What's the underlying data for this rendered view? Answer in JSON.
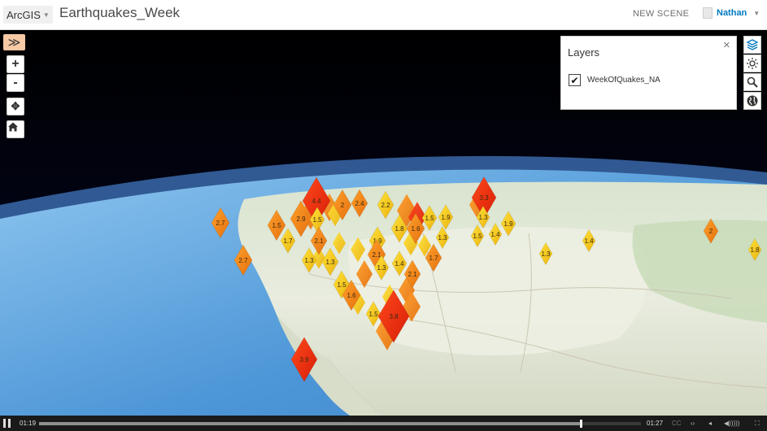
{
  "header": {
    "brand": "ArcGIS",
    "title": "Earthquakes_Week",
    "new_scene": "NEW SCENE",
    "user": "Nathan"
  },
  "toolbar": {
    "expand": "≫",
    "zoom_in": "+",
    "zoom_out": "-",
    "pan": "✥",
    "home": "⌂"
  },
  "layers": {
    "title": "Layers",
    "close": "×",
    "items": [
      {
        "name": "WeekOfQuakes_NA",
        "checked": true,
        "check_glyph": "✔"
      }
    ]
  },
  "right_tools": [
    "layers-icon",
    "daylight-icon",
    "search-icon",
    "basemap-globe-icon"
  ],
  "quake_labels": [
    "2.7",
    "1.5",
    "2.9",
    "4.4",
    "1.5",
    "2",
    "2.4",
    "2.2",
    "1.5",
    "1.9",
    "3.3",
    "1.3",
    "1.9",
    "1.7",
    "2.1",
    "1.9",
    "1.8",
    "1.6",
    "1.3",
    "1.5",
    "1.4",
    "2",
    "1.8",
    "2.7",
    "1.3",
    "1.3",
    "2.1",
    "1.4",
    "1.7",
    "1.3",
    "2.1",
    "1.5",
    "1.6",
    "1.4",
    "1.5",
    "3.9",
    "3.8",
    "1.3"
  ],
  "video": {
    "elapsed": "01:19",
    "duration": "01:27",
    "progress": 0.9,
    "cc": "CC",
    "controls": [
      "‹›",
      "◂",
      "◀)))))",
      "⛶"
    ]
  },
  "colors": {
    "header_bg": "#ffffff",
    "accent_blue": "#0079c1",
    "expand_btn": "#f7c9a5",
    "quake_red": "#ee2a10",
    "quake_orange": "#f58a1a",
    "quake_yellow": "#f7cf18"
  }
}
